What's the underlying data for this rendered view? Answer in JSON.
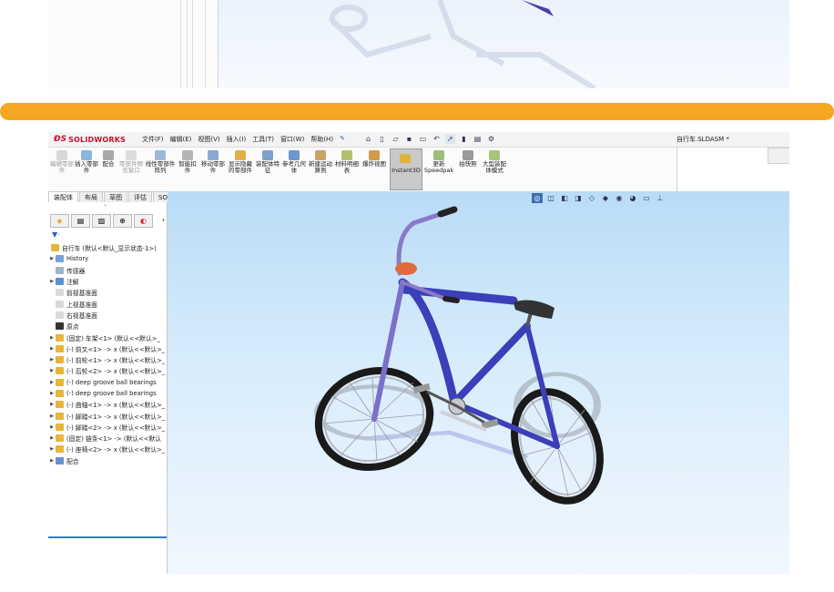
{
  "menubar": {
    "brand": "SOLIDWORKS",
    "menus": [
      "文件(F)",
      "编辑(E)",
      "视图(V)",
      "插入(I)",
      "工具(T)",
      "窗口(W)",
      "帮助(H)"
    ],
    "document_title": "自行车.SLDASM *"
  },
  "ribbon": {
    "buttons": [
      {
        "label": "编辑零部件",
        "enabled": false
      },
      {
        "label": "插入零部件",
        "enabled": true
      },
      {
        "label": "配合",
        "enabled": true
      },
      {
        "label": "零部件预览窗口",
        "enabled": false
      },
      {
        "label": "线性零部件阵列",
        "enabled": true
      },
      {
        "label": "智能扣件",
        "enabled": true
      },
      {
        "label": "移动零部件",
        "enabled": true
      },
      {
        "label": "显示隐藏的零部件",
        "enabled": true
      },
      {
        "label": "装配体特征",
        "enabled": true
      },
      {
        "label": "参考几何体",
        "enabled": true
      },
      {
        "label": "新建运动算例",
        "enabled": true
      },
      {
        "label": "材料明细表",
        "enabled": true
      },
      {
        "label": "爆炸视图",
        "enabled": true
      },
      {
        "label": "Instant3D",
        "enabled": true
      },
      {
        "label": "更新Speedpak",
        "enabled": true
      },
      {
        "label": "拍快照",
        "enabled": true
      },
      {
        "label": "大型装配体模式",
        "enabled": true
      }
    ]
  },
  "tabs": [
    "装配体",
    "布局",
    "草图",
    "评估",
    "SOLIDWORKS 插件"
  ],
  "active_tab": "装配体",
  "tree": {
    "root": "自行车 (默认<默认_显示状态-1>)",
    "items": [
      {
        "label": "History",
        "expandable": true
      },
      {
        "label": "传感器",
        "expandable": false
      },
      {
        "label": "注解",
        "expandable": true
      },
      {
        "label": "前视基准面",
        "expandable": false
      },
      {
        "label": "上视基准面",
        "expandable": false
      },
      {
        "label": "右视基准面",
        "expandable": false
      },
      {
        "label": "原点",
        "expandable": false
      },
      {
        "label": "(固定) 车架<1> (默认<<默认>_",
        "expandable": true
      },
      {
        "label": "(-) 前叉<1> -> x (默认<<默认>_",
        "expandable": true
      },
      {
        "label": "(-) 前轮<1> -> x (默认<<默认>_",
        "expandable": true
      },
      {
        "label": "(-) 后轮<2> -> x (默认<<默认>_",
        "expandable": true
      },
      {
        "label": "(-) deep groove ball bearings",
        "expandable": true
      },
      {
        "label": "(-) deep groove ball bearings",
        "expandable": true
      },
      {
        "label": "(-) 曲轴<1> -> x (默认<<默认>_",
        "expandable": true
      },
      {
        "label": "(-) 脚踏<1> -> x (默认<<默认>_",
        "expandable": true
      },
      {
        "label": "(-) 脚踏<2> -> x (默认<<默认>_",
        "expandable": true
      },
      {
        "label": "(固定) 链条<1> -> (默认<<默认",
        "expandable": true
      },
      {
        "label": "(-) 座椅<2> -> x (默认<<默认>_",
        "expandable": true
      },
      {
        "label": "配合",
        "expandable": true
      }
    ]
  },
  "colors": {
    "accent_orange": "#f5a623",
    "bike_frame": "#3b3fb8",
    "brand_red": "#c8102e"
  },
  "icons": {
    "panel_tabs": [
      "feature-manager-icon",
      "property-manager-icon",
      "configuration-manager-icon",
      "dimxpert-icon",
      "display-manager-icon"
    ]
  }
}
